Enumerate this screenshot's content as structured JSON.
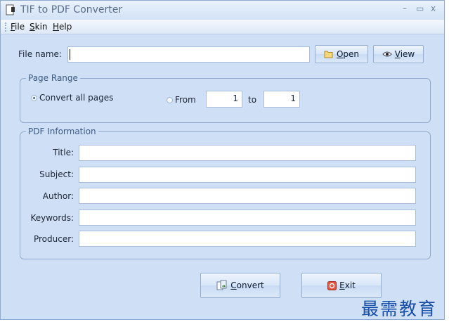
{
  "window": {
    "title": "TIF to PDF Converter",
    "controls": {
      "minimize": "–",
      "maximize": "▭",
      "close": "x"
    }
  },
  "menu": [
    {
      "accel": "F",
      "rest": "ile"
    },
    {
      "accel": "S",
      "rest": "kin"
    },
    {
      "accel": "H",
      "rest": "elp"
    }
  ],
  "file": {
    "label": "File name:",
    "value": "",
    "open": {
      "accel": "O",
      "rest": "pen"
    },
    "view": {
      "accel": "V",
      "rest": "iew"
    }
  },
  "page_range": {
    "title": "Page Range",
    "convert_all": "Convert all pages",
    "from_label": "From",
    "from_value": "1",
    "to_label": "to",
    "to_value": "1",
    "selected": "all"
  },
  "pdf_info": {
    "title": "PDF Information",
    "fields": [
      {
        "label": "Title:",
        "value": ""
      },
      {
        "label": "Subject:",
        "value": ""
      },
      {
        "label": "Author:",
        "value": ""
      },
      {
        "label": "Keywords:",
        "value": ""
      },
      {
        "label": "Producer:",
        "value": ""
      }
    ]
  },
  "actions": {
    "convert": {
      "accel": "C",
      "rest": "onvert"
    },
    "exit": {
      "accel": "E",
      "rest": "xit"
    }
  },
  "watermark": "最需教育",
  "colors": {
    "background": "#cfe0f6",
    "border": "#8fa9ce",
    "accent": "#3c5a84",
    "watermark": "#1a4fa8"
  },
  "icons": [
    "app-icon",
    "folder-icon",
    "eye-icon",
    "convert-icon",
    "exit-icon"
  ]
}
